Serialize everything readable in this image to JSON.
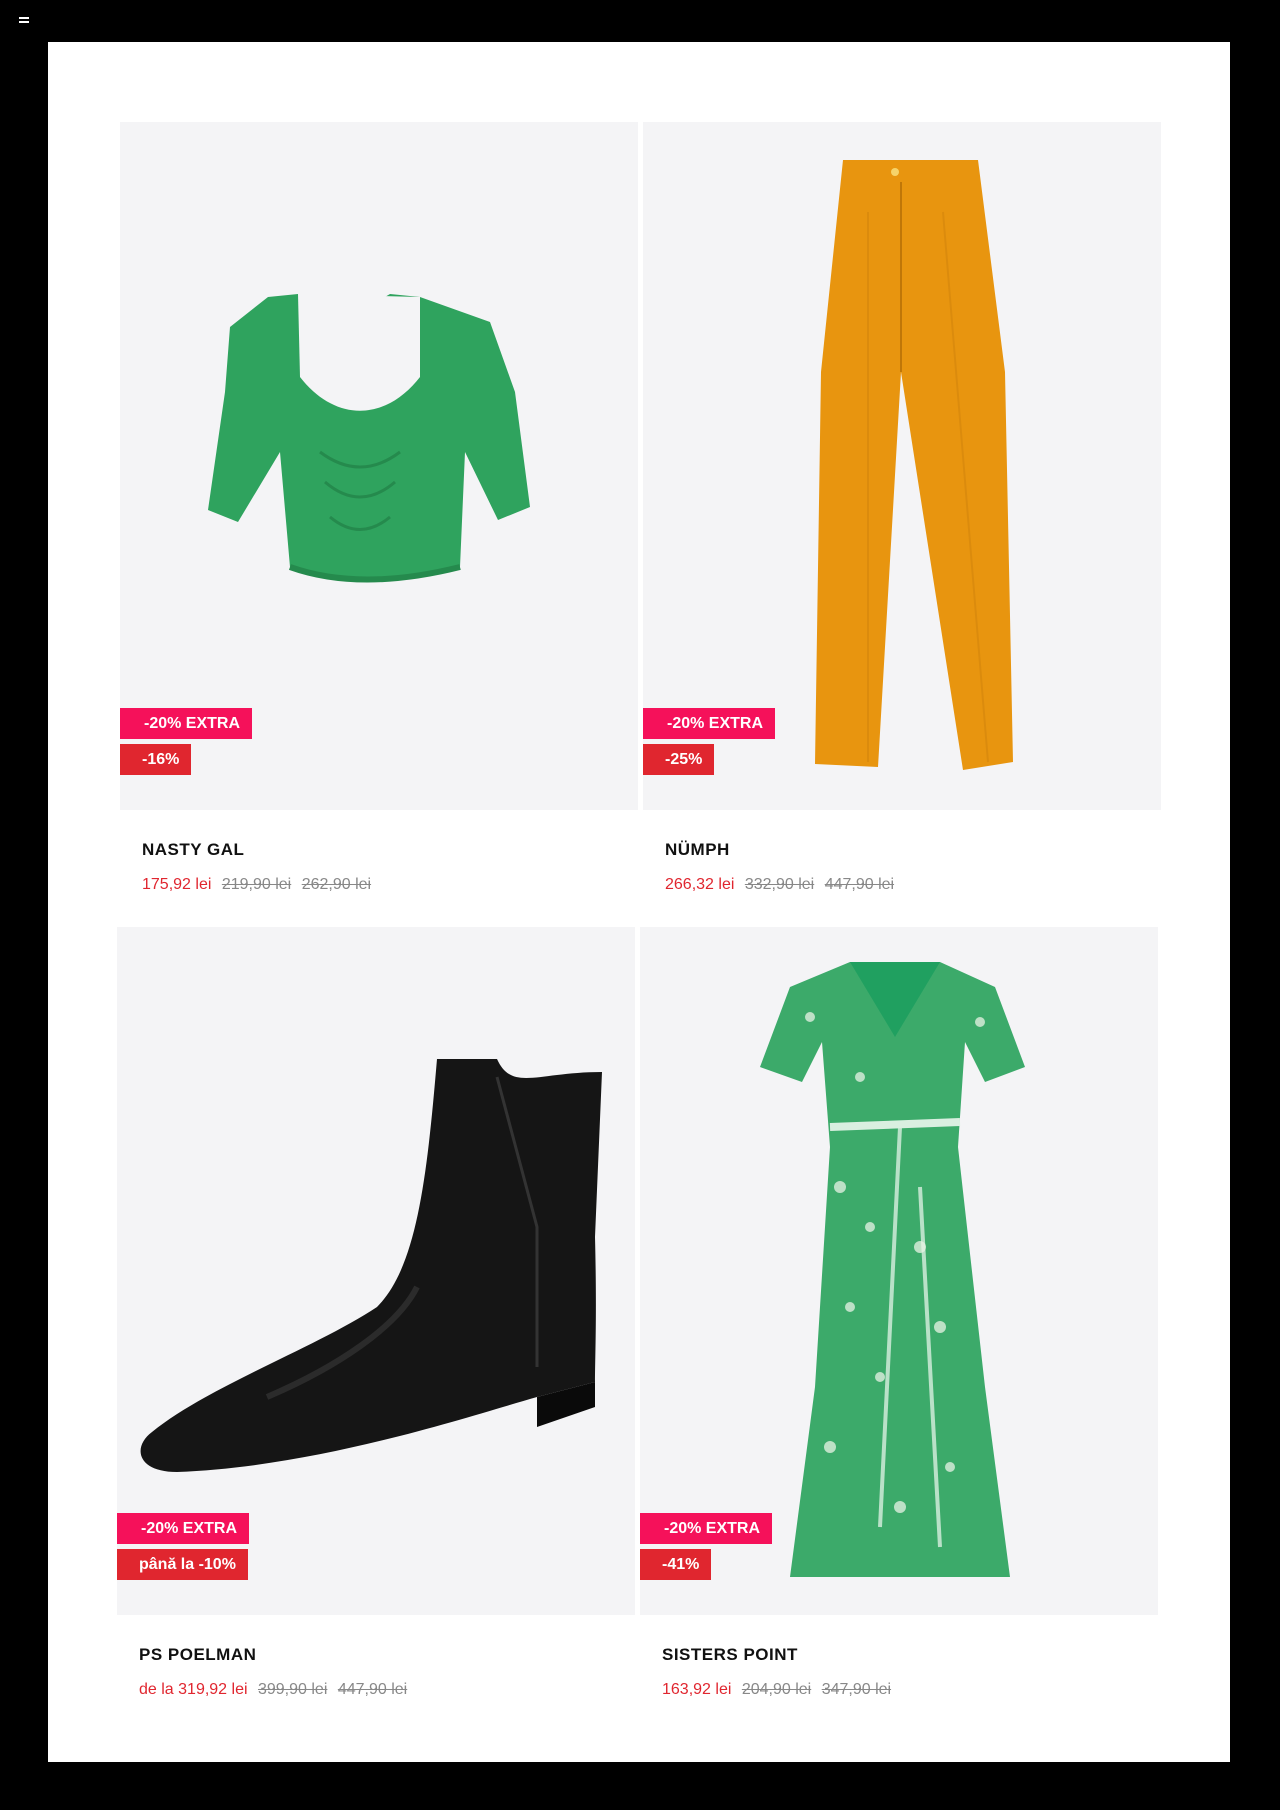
{
  "products": [
    {
      "brand": "NASTY GAL",
      "badge_extra": "-20% EXTRA",
      "badge_discount": "-16%",
      "price_now": "175,92 lei",
      "price_old_1": "219,90 lei",
      "price_old_2": "262,90 lei",
      "item": "green-ruched-crop-top",
      "color": "#2fa35e"
    },
    {
      "brand": "NÜMPH",
      "badge_extra": "-20% EXTRA",
      "badge_discount": "-25%",
      "price_now": "266,32 lei",
      "price_old_1": "332,90 lei",
      "price_old_2": "447,90 lei",
      "item": "orange-wide-leg-trousers",
      "color": "#e8950f"
    },
    {
      "brand": "PS POELMAN",
      "badge_extra": "-20% EXTRA",
      "badge_discount": "până la -10%",
      "price_now": "de la 319,92 lei",
      "price_old_1": "399,90 lei",
      "price_old_2": "447,90 lei",
      "item": "black-chelsea-boot",
      "color": "#151515"
    },
    {
      "brand": "SISTERS POINT",
      "badge_extra": "-20% EXTRA",
      "badge_discount": "-41%",
      "price_now": "163,92 lei",
      "price_old_1": "204,90 lei",
      "price_old_2": "347,90 lei",
      "item": "green-floral-wrap-dress",
      "color": "#3caa6a"
    }
  ],
  "colors": {
    "extra_badge": "#f5115a",
    "discount_badge": "#e0262f",
    "price_now": "#e0262f"
  },
  "icons": {
    "menu": "hamburger-menu-icon"
  }
}
